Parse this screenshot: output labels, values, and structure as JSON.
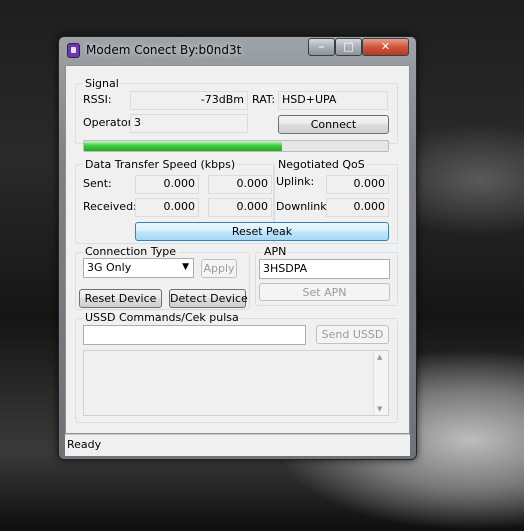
{
  "window": {
    "title": "Modem Conect By:b0nd3t"
  },
  "signal": {
    "group_label": "Signal",
    "rssi_label": "RSSI:",
    "rssi_value": "-73dBm",
    "rat_label": "RAT:",
    "rat_value": "HSD+UPA",
    "operator_label": "Operator:",
    "operator_value": "3",
    "connect_label": "Connect",
    "signal_level": 0.65
  },
  "transfer": {
    "group_label": "Data Transfer Speed (kbps)",
    "sent_label": "Sent:",
    "sent_current": "0.000",
    "sent_peak": "0.000",
    "received_label": "Received:",
    "received_current": "0.000",
    "received_peak": "0.000",
    "reset_peak_label": "Reset Peak"
  },
  "qos": {
    "group_label": "Negotiated QoS",
    "uplink_label": "Uplink:",
    "uplink_value": "0.000",
    "downlink_label": "Downlink:",
    "downlink_value": "0.000"
  },
  "connection": {
    "group_label": "Connection Type",
    "selected": "3G Only",
    "apply_label": "Apply",
    "reset_device_label": "Reset Device",
    "detect_device_label": "Detect Device"
  },
  "apn": {
    "group_label": "APN",
    "value": "3HSDPA",
    "set_label": "Set APN"
  },
  "ussd": {
    "group_label": "USSD Commands/Cek pulsa",
    "input_value": "",
    "send_label": "Send USSD",
    "output_text": ""
  },
  "status": {
    "text": "Ready"
  },
  "colors": {
    "signal_green": "#3fcf3f",
    "accent": "#3c7fb1"
  }
}
